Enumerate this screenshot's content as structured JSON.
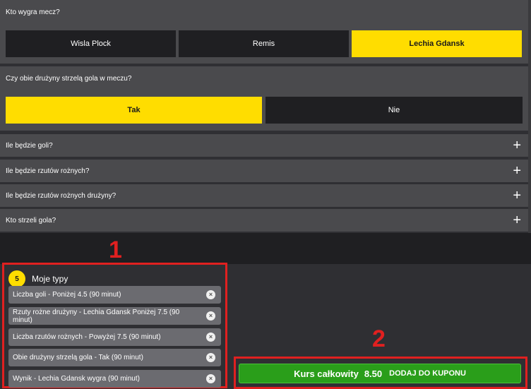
{
  "markets": {
    "winner": {
      "question": "Kto wygra mecz?",
      "options": [
        "Wisla Plock",
        "Remis",
        "Lechia Gdansk"
      ]
    },
    "btts": {
      "question": "Czy obie drużyny strzelą gola w meczu?",
      "options": [
        "Tak",
        "Nie"
      ]
    },
    "collapsed": [
      "Ile będzie goli?",
      "Ile będzie rzutów rożnych?",
      "Ile będzie rzutów rożnych drużyny?",
      "Kto strzeli gola?"
    ]
  },
  "slip": {
    "count": "5",
    "title": "Moje typy",
    "bets": [
      "Liczba goli - Poniżej 4.5 (90 minut)",
      "Rzuty rożne drużyny - Lechia Gdansk Poniżej 7.5 (90 minut)",
      "Liczba rzutów rożnych - Powyżej 7.5 (90 minut)",
      "Obie drużyny strzelą gola - Tak (90 minut)",
      "Wynik - Lechia Gdansk wygra (90 minut)"
    ],
    "total_odds_label": "Kurs całkowity",
    "total_odds_value": "8.50",
    "add_button_label": "DODAJ DO KUPONU"
  },
  "annotations": [
    "1",
    "2"
  ],
  "icons": {
    "expand": "plus-icon",
    "remove": "close-circle-icon",
    "count": "badge"
  },
  "colors": {
    "selected": "#ffdd00",
    "action": "#2a9e1a",
    "highlight": "#e02020"
  }
}
